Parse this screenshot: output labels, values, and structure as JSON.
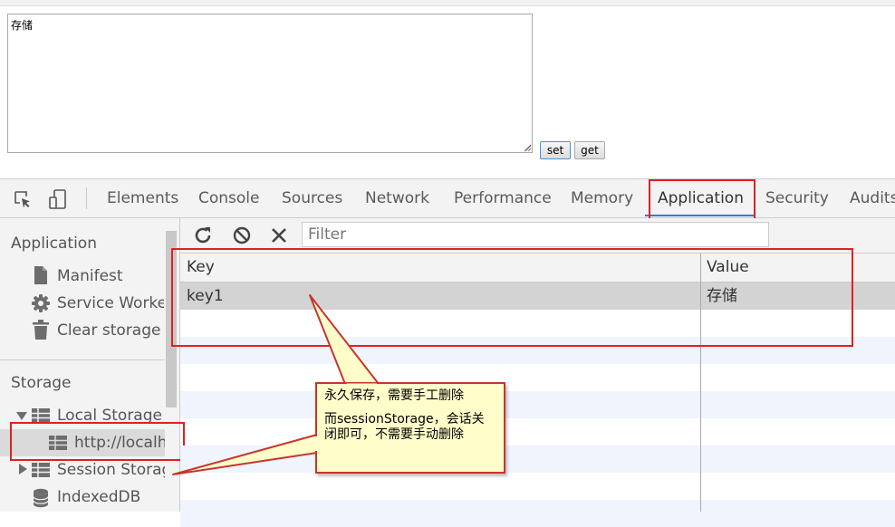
{
  "page": {
    "textarea_value": "存储",
    "set_label": "set",
    "get_label": "get"
  },
  "devtools": {
    "tabs": [
      "Elements",
      "Console",
      "Sources",
      "Network",
      "Performance",
      "Memory",
      "Application",
      "Security",
      "Audits"
    ],
    "active_tab": "Application",
    "accent": "#3879d9"
  },
  "sidebar": {
    "application_header": "Application",
    "application_items": [
      {
        "label": "Manifest",
        "icon": "document-icon"
      },
      {
        "label": "Service Workers",
        "icon": "gear-icon"
      },
      {
        "label": "Clear storage",
        "icon": "trash-icon"
      }
    ],
    "storage_header": "Storage",
    "storage_items": [
      {
        "label": "Local Storage",
        "icon": "table-icon"
      },
      {
        "label": "http://localhost",
        "icon": "table-icon"
      },
      {
        "label": "Session Storage",
        "icon": "table-icon"
      },
      {
        "label": "IndexedDB",
        "icon": "database-icon"
      }
    ]
  },
  "storage_pane": {
    "filter_placeholder": "Filter",
    "columns": [
      "Key",
      "Value"
    ],
    "rows": [
      {
        "key": "key1",
        "value": "存储"
      }
    ]
  },
  "annotation": {
    "line1": "永久保存，需要手工删除",
    "line2": "而sessionStorage，会话关闭即可，不需要手动删除",
    "border_color": "#e02020",
    "fill_color": "#fffecb"
  }
}
